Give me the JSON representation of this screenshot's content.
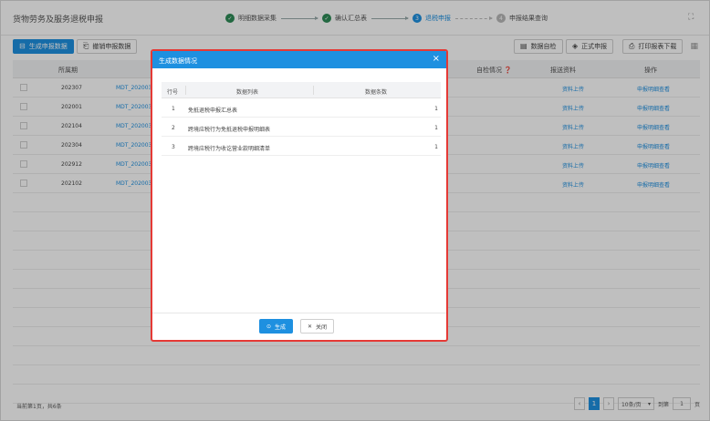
{
  "page": {
    "title": "货物劳务及服务退税申报",
    "steps": [
      {
        "label": "明细数据采集",
        "marker": "✓"
      },
      {
        "label": "确认汇总表",
        "marker": "✓"
      },
      {
        "label": "退税申报",
        "marker": "3"
      },
      {
        "label": "申报结果查询",
        "marker": "4"
      }
    ]
  },
  "toolbar": {
    "generate_label": "生成申报数据",
    "revoke_label": "撤销申报数据",
    "selfcheck_label": "数据自检",
    "formal_label": "正式申报",
    "print_label": "打印报表下载"
  },
  "table": {
    "headers": {
      "period": "所属期",
      "selfcheck": "自检情况",
      "submit": "报送资料",
      "ops": "操作"
    },
    "rows": [
      {
        "period": "202307",
        "code": "MDT_202003",
        "submit": "资料上传",
        "op": "申报明细查看"
      },
      {
        "period": "202001",
        "code": "MDT_202003",
        "submit": "资料上传",
        "op": "申报明细查看"
      },
      {
        "period": "202104",
        "code": "MDT_202003",
        "submit": "资料上传",
        "op": "申报明细查看"
      },
      {
        "period": "202304",
        "code": "MDT_202003",
        "submit": "资料上传",
        "op": "申报明细查看"
      },
      {
        "period": "202912",
        "code": "MDT_202003",
        "submit": "资料上传",
        "op": "申报明细查看"
      },
      {
        "period": "202102",
        "code": "MDT_202003",
        "submit": "资料上传",
        "op": "申报明细查看"
      }
    ]
  },
  "footer": {
    "info": "当前第1页，共6条",
    "page": "1",
    "page_size": "10条/页",
    "goto_label": "到第",
    "goto_value": "1",
    "page_unit": "页"
  },
  "modal": {
    "title": "生成数据情况",
    "headers": {
      "row_no": "行号",
      "list": "数据列表",
      "count": "数据条数"
    },
    "rows": [
      {
        "no": "1",
        "name": "免抵退税申报汇总表",
        "count": "1"
      },
      {
        "no": "2",
        "name": "跨境应税行为免抵退税申报明细表",
        "count": "1"
      },
      {
        "no": "3",
        "name": "跨境应税行为收讫营业款明细清单",
        "count": "1"
      }
    ],
    "generate_label": "生成",
    "close_label": "关闭"
  }
}
